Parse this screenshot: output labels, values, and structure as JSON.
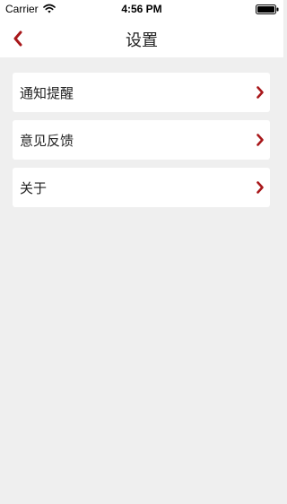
{
  "status_bar": {
    "carrier": "Carrier",
    "time": "4:56 PM",
    "wifi_icon": "wifi-icon",
    "battery_icon": "battery-full-icon"
  },
  "nav_bar": {
    "title": "设置",
    "back_icon": "chevron-left-icon"
  },
  "colors": {
    "accent": "#a8171a",
    "background": "#efefef",
    "card": "#ffffff"
  },
  "menu": {
    "items": [
      {
        "label": "通知提醒",
        "icon": "chevron-right-icon"
      },
      {
        "label": "意见反馈",
        "icon": "chevron-right-icon"
      },
      {
        "label": "关于",
        "icon": "chevron-right-icon"
      }
    ]
  }
}
